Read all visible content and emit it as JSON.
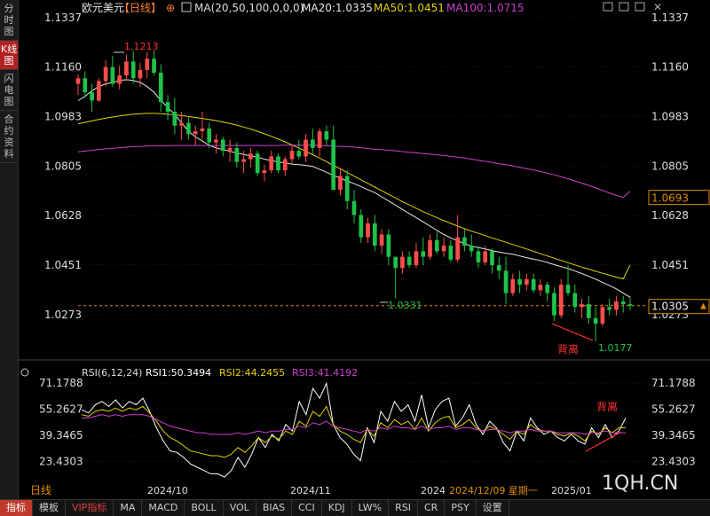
{
  "sidebar": {
    "items": [
      {
        "label": "分时图",
        "active": false
      },
      {
        "label": "K线图",
        "active": true
      },
      {
        "label": "闪电图",
        "active": false
      },
      {
        "label": "合约资料",
        "active": false
      }
    ]
  },
  "header": {
    "symbol": "欧元美元",
    "period": "【日线】",
    "ma_params": "MA(20,50,100,0,0,0)",
    "ma20_label": "MA20:1.0335",
    "ma50_label": "MA50:1.0451",
    "ma100_label": "MA100:1.0715"
  },
  "colors": {
    "up": "#ff4d4d",
    "down": "#1fc24a",
    "ma20": "#e8e8e8",
    "ma50": "#e6d200",
    "ma100": "#d23cd2",
    "rsi1": "#ffffff",
    "rsi2": "#e6d200",
    "rsi3": "#d23cd2",
    "annotation": "#ff3030",
    "price_line": "#e08a00",
    "grid": "#3a3a3a"
  },
  "chart_data": [
    {
      "type": "candlestick",
      "title": "欧元美元 【日线】",
      "y_ticks": [
        "1.1337",
        "1.1160",
        "1.0983",
        "1.0805",
        "1.0628",
        "1.0451",
        "1.0273"
      ],
      "ylim": [
        1.0177,
        1.1337
      ],
      "x_labels": [
        "2024/10",
        "2024/11",
        "2024",
        "2025/01"
      ],
      "candles": [
        [
          1.11,
          1.1135,
          1.106,
          1.112
        ],
        [
          1.112,
          1.1145,
          1.105,
          1.107
        ],
        [
          1.107,
          1.11,
          1.1,
          1.104
        ],
        [
          1.104,
          1.112,
          1.1035,
          1.111
        ],
        [
          1.111,
          1.1185,
          1.109,
          1.116
        ],
        [
          1.116,
          1.12,
          1.109,
          1.11
        ],
        [
          1.11,
          1.1165,
          1.108,
          1.113
        ],
        [
          1.113,
          1.1205,
          1.111,
          1.118
        ],
        [
          1.118,
          1.122,
          1.11,
          1.112
        ],
        [
          1.112,
          1.1175,
          1.109,
          1.115
        ],
        [
          1.115,
          1.1213,
          1.112,
          1.119
        ],
        [
          1.119,
          1.122,
          1.113,
          1.114
        ],
        [
          1.114,
          1.117,
          1.1,
          1.1035
        ],
        [
          1.1035,
          1.106,
          1.097,
          1.1
        ],
        [
          1.1,
          1.105,
          1.092,
          1.095
        ],
        [
          1.095,
          1.1,
          1.09,
          1.096
        ],
        [
          1.096,
          1.098,
          1.09,
          1.092
        ],
        [
          1.092,
          1.095,
          1.088,
          1.093
        ],
        [
          1.093,
          1.1,
          1.09,
          1.094
        ],
        [
          1.094,
          1.096,
          1.087,
          1.089
        ],
        [
          1.089,
          1.092,
          1.085,
          1.09
        ],
        [
          1.09,
          1.091,
          1.084,
          1.086
        ],
        [
          1.086,
          1.09,
          1.082,
          1.087
        ],
        [
          1.087,
          1.089,
          1.08,
          1.082
        ],
        [
          1.082,
          1.086,
          1.078,
          1.083
        ],
        [
          1.083,
          1.087,
          1.08,
          1.085
        ],
        [
          1.085,
          1.086,
          1.077,
          1.078
        ],
        [
          1.078,
          1.081,
          1.075,
          1.079
        ],
        [
          1.079,
          1.086,
          1.078,
          1.084
        ],
        [
          1.084,
          1.085,
          1.078,
          1.079
        ],
        [
          1.079,
          1.084,
          1.077,
          1.083
        ],
        [
          1.083,
          1.088,
          1.081,
          1.086
        ],
        [
          1.086,
          1.09,
          1.083,
          1.084
        ],
        [
          1.084,
          1.092,
          1.082,
          1.09
        ],
        [
          1.09,
          1.094,
          1.085,
          1.087
        ],
        [
          1.087,
          1.094,
          1.084,
          1.093
        ],
        [
          1.093,
          1.095,
          1.088,
          1.09
        ],
        [
          1.09,
          1.095,
          1.08,
          1.072
        ],
        [
          1.072,
          1.08,
          1.07,
          1.077
        ],
        [
          1.077,
          1.079,
          1.065,
          1.068
        ],
        [
          1.068,
          1.072,
          1.06,
          1.063
        ],
        [
          1.063,
          1.065,
          1.053,
          1.055
        ],
        [
          1.055,
          1.062,
          1.053,
          1.06
        ],
        [
          1.06,
          1.063,
          1.05,
          1.052
        ],
        [
          1.052,
          1.058,
          1.049,
          1.056
        ],
        [
          1.056,
          1.058,
          1.045,
          1.048
        ],
        [
          1.048,
          1.045,
          1.0331,
          1.044
        ],
        [
          1.044,
          1.05,
          1.042,
          1.048
        ],
        [
          1.048,
          1.05,
          1.044,
          1.045
        ],
        [
          1.045,
          1.053,
          1.044,
          1.05
        ],
        [
          1.05,
          1.055,
          1.045,
          1.048
        ],
        [
          1.048,
          1.056,
          1.047,
          1.054
        ],
        [
          1.054,
          1.057,
          1.049,
          1.05
        ],
        [
          1.05,
          1.055,
          1.048,
          1.052
        ],
        [
          1.052,
          1.054,
          1.046,
          1.047
        ],
        [
          1.047,
          1.063,
          1.046,
          1.055
        ],
        [
          1.055,
          1.058,
          1.05,
          1.052
        ],
        [
          1.052,
          1.056,
          1.048,
          1.05
        ],
        [
          1.05,
          1.052,
          1.044,
          1.046
        ],
        [
          1.046,
          1.052,
          1.045,
          1.05
        ],
        [
          1.05,
          1.051,
          1.042,
          1.045
        ],
        [
          1.045,
          1.048,
          1.04,
          1.043
        ],
        [
          1.043,
          1.048,
          1.031,
          1.035
        ],
        [
          1.035,
          1.042,
          1.034,
          1.04
        ],
        [
          1.04,
          1.043,
          1.035,
          1.038
        ],
        [
          1.038,
          1.042,
          1.036,
          1.04
        ],
        [
          1.04,
          1.042,
          1.035,
          1.036
        ],
        [
          1.036,
          1.04,
          1.034,
          1.038
        ],
        [
          1.038,
          1.039,
          1.032,
          1.035
        ],
        [
          1.035,
          1.037,
          1.025,
          1.027
        ],
        [
          1.027,
          1.04,
          1.026,
          1.038
        ],
        [
          1.038,
          1.045,
          1.034,
          1.035
        ],
        [
          1.035,
          1.038,
          1.028,
          1.03
        ],
        [
          1.03,
          1.033,
          1.026,
          1.031
        ],
        [
          1.031,
          1.034,
          1.024,
          1.026
        ],
        [
          1.026,
          1.03,
          1.0177,
          1.024
        ],
        [
          1.024,
          1.031,
          1.023,
          1.03
        ],
        [
          1.03,
          1.033,
          1.027,
          1.029
        ],
        [
          1.029,
          1.034,
          1.027,
          1.032
        ],
        [
          1.032,
          1.034,
          1.028,
          1.031
        ],
        [
          1.031,
          1.034,
          1.029,
          1.0305
        ]
      ],
      "series": [
        {
          "name": "MA20",
          "values": [
            1.104,
            1.1055,
            1.1075,
            1.109,
            1.11,
            1.1105,
            1.1112,
            1.1115,
            1.1112,
            1.1105,
            1.109,
            1.107,
            1.104,
            1.1015,
            1.099,
            1.096,
            1.093,
            1.091,
            1.0895,
            1.088,
            1.087,
            1.0865,
            1.0858,
            1.0852,
            1.0847,
            1.0842,
            1.0837,
            1.083,
            1.0825,
            1.082,
            1.0817,
            1.0812,
            1.081,
            1.0808,
            1.0804,
            1.0794,
            1.0783,
            1.0772,
            1.0762,
            1.0752,
            1.0742,
            1.0732,
            1.072,
            1.071,
            1.0695,
            1.068,
            1.0665,
            1.065,
            1.0635,
            1.062,
            1.0605,
            1.059,
            1.0575,
            1.056,
            1.0548,
            1.0537,
            1.0528,
            1.0518,
            1.0513,
            1.0508,
            1.0502,
            1.0497,
            1.0493,
            1.0489,
            1.0483,
            1.0477,
            1.0472,
            1.0467,
            1.046,
            1.0452,
            1.0445,
            1.0438,
            1.0429,
            1.042,
            1.041,
            1.04,
            1.0388,
            1.0377,
            1.0365,
            1.035,
            1.0335
          ]
        },
        {
          "name": "MA50",
          "values": [
            1.0957,
            1.0962,
            1.0967,
            1.0972,
            1.0977,
            1.0981,
            1.0985,
            1.0988,
            1.0991,
            1.0993,
            1.0994,
            1.0994,
            1.0993,
            1.0991,
            1.0989,
            1.0986,
            1.0983,
            1.0979,
            1.0976,
            1.0972,
            1.0968,
            1.0963,
            1.0958,
            1.0952,
            1.0945,
            1.0938,
            1.093,
            1.0921,
            1.0912,
            1.0902,
            1.0892,
            1.0881,
            1.087,
            1.0858,
            1.0846,
            1.0834,
            1.0821,
            1.0808,
            1.0795,
            1.0782,
            1.0769,
            1.0756,
            1.0743,
            1.073,
            1.0717,
            1.0704,
            1.0691,
            1.0678,
            1.0666,
            1.0654,
            1.0642,
            1.0631,
            1.062,
            1.061,
            1.06,
            1.059,
            1.0581,
            1.0572,
            1.0564,
            1.0556,
            1.0548,
            1.054,
            1.0532,
            1.0524,
            1.0516,
            1.0508,
            1.05,
            1.0491,
            1.0483,
            1.0475,
            1.0467,
            1.0459,
            1.0451,
            1.0443,
            1.0436,
            1.0428,
            1.0421,
            1.0414,
            1.0407,
            1.0401,
            1.0451
          ]
        },
        {
          "name": "MA100",
          "values": [
            1.0856,
            1.0859,
            1.0862,
            1.0865,
            1.0867,
            1.0869,
            1.0871,
            1.0873,
            1.0875,
            1.0876,
            1.0877,
            1.0878,
            1.0878,
            1.0878,
            1.0879,
            1.0879,
            1.0879,
            1.0879,
            1.0879,
            1.0879,
            1.0879,
            1.0879,
            1.0879,
            1.0879,
            1.0879,
            1.0879,
            1.0879,
            1.0879,
            1.0879,
            1.0879,
            1.088,
            1.088,
            1.088,
            1.088,
            1.088,
            1.0879,
            1.0878,
            1.0877,
            1.0876,
            1.0875,
            1.0873,
            1.0871,
            1.0868,
            1.0866,
            1.0864,
            1.0862,
            1.086,
            1.0857,
            1.0855,
            1.0853,
            1.085,
            1.0848,
            1.0845,
            1.0843,
            1.084,
            1.0837,
            1.0834,
            1.083,
            1.0826,
            1.0822,
            1.0818,
            1.0814,
            1.081,
            1.0806,
            1.0801,
            1.0796,
            1.0791,
            1.0786,
            1.078,
            1.0774,
            1.0767,
            1.076,
            1.0752,
            1.0744,
            1.0736,
            1.0727,
            1.0718,
            1.0709,
            1.07,
            1.0693,
            1.0715
          ]
        }
      ],
      "annotations": {
        "high_label": "1.1213",
        "low_label_mid": "1.0331",
        "low_label": "1.0177",
        "divergence_label": "背离",
        "current_price": "1.0305",
        "ma100_tag": "1.0693"
      }
    },
    {
      "type": "line",
      "title": "RSI(6,12,24)",
      "legend": [
        "RSI1:50.3494",
        "RSI2:44.2455",
        "RSI3:41.4192"
      ],
      "y_ticks": [
        "71.1788",
        "55.2627",
        "39.3465",
        "23.4303"
      ],
      "ylim": [
        13,
        75
      ],
      "divergence_label": "背离",
      "series": [
        {
          "name": "RSI1",
          "values": [
            55,
            53,
            58,
            60,
            57,
            61,
            56,
            60,
            58,
            62,
            54,
            44,
            36,
            30,
            29,
            26,
            22,
            20,
            18,
            16,
            16,
            14,
            18,
            26,
            20,
            28,
            38,
            32,
            40,
            36,
            46,
            42,
            60,
            52,
            68,
            62,
            71,
            46,
            38,
            34,
            28,
            24,
            44,
            35,
            54,
            48,
            60,
            54,
            58,
            48,
            64,
            44,
            55,
            60,
            62,
            45,
            50,
            58,
            46,
            40,
            48,
            44,
            35,
            30,
            42,
            36,
            50,
            44,
            40,
            42,
            38,
            36,
            40,
            36,
            34,
            44,
            38,
            46,
            38,
            42,
            50
          ]
        },
        {
          "name": "RSI2",
          "values": [
            52,
            51,
            54,
            55,
            54,
            56,
            54,
            56,
            55,
            57,
            53,
            48,
            42,
            38,
            36,
            33,
            30,
            29,
            28,
            27,
            27,
            26,
            28,
            32,
            29,
            33,
            38,
            35,
            39,
            37,
            42,
            40,
            48,
            45,
            54,
            51,
            57,
            46,
            42,
            40,
            37,
            35,
            43,
            39,
            47,
            44,
            49,
            46,
            48,
            43,
            50,
            42,
            47,
            50,
            51,
            44,
            46,
            49,
            44,
            42,
            45,
            43,
            40,
            37,
            42,
            40,
            46,
            43,
            42,
            42,
            40,
            39,
            41,
            39,
            36,
            42,
            40,
            44,
            41,
            44,
            44
          ]
        },
        {
          "name": "RSI3",
          "values": [
            50,
            50,
            51,
            52,
            51,
            52,
            51,
            52,
            52,
            52,
            51,
            49,
            47,
            45,
            44,
            43,
            42,
            41,
            41,
            40,
            40,
            40,
            40,
            41,
            40,
            41,
            42,
            41,
            42,
            42,
            43,
            43,
            45,
            44,
            47,
            46,
            48,
            45,
            44,
            43,
            42,
            41,
            43,
            42,
            44,
            43,
            45,
            44,
            44,
            43,
            45,
            43,
            44,
            44,
            45,
            43,
            44,
            44,
            43,
            42,
            43,
            43,
            42,
            41,
            42,
            42,
            43,
            42,
            42,
            42,
            41,
            41,
            41,
            41,
            40,
            41,
            41,
            42,
            41,
            41,
            41
          ]
        }
      ]
    }
  ],
  "top_right_icons": [
    "image-icon",
    "grid-icon",
    "expand-icon",
    "close-icon"
  ],
  "watermark": "1QH.CN",
  "date_info": "2024/12/09 星期一",
  "period_tag": "日线",
  "bottom_tabs": [
    {
      "label": "指标",
      "active": true,
      "vip": false
    },
    {
      "label": "模板",
      "active": false,
      "vip": false
    },
    {
      "label": "VIP指标",
      "active": false,
      "vip": true
    },
    {
      "label": "MA",
      "active": false,
      "vip": false
    },
    {
      "label": "MACD",
      "active": false,
      "vip": false
    },
    {
      "label": "BOLL",
      "active": false,
      "vip": false
    },
    {
      "label": "VOL",
      "active": false,
      "vip": false
    },
    {
      "label": "BIAS",
      "active": false,
      "vip": false
    },
    {
      "label": "CCI",
      "active": false,
      "vip": false
    },
    {
      "label": "KDJ",
      "active": false,
      "vip": false
    },
    {
      "label": "LW%",
      "active": false,
      "vip": false
    },
    {
      "label": "RSI",
      "active": false,
      "vip": false
    },
    {
      "label": "CR",
      "active": false,
      "vip": false
    },
    {
      "label": "PSY",
      "active": false,
      "vip": false
    },
    {
      "label": "设置",
      "active": false,
      "vip": false
    }
  ]
}
